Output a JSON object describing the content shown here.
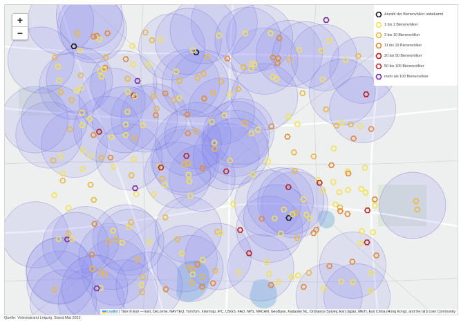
{
  "map": {
    "zoom_in_label": "+",
    "zoom_out_label": "−",
    "colors": {
      "background": "#eef0ef",
      "circle_fill": "#8a86f0",
      "circle_stroke": "#6e6ac8",
      "water": "#b9d3e6",
      "road_major": "#ffffff",
      "road_minor": "#d4d4d4"
    }
  },
  "legend": {
    "items": [
      {
        "label": "Anzahl der Bienenvölker unbekannt",
        "color": "#1a1a1a"
      },
      {
        "label": "1 bis 2 Bienenvölker",
        "color": "#f2e15c"
      },
      {
        "label": "3 bis 10 Bienenvölker",
        "color": "#e8b84a"
      },
      {
        "label": "11 bis 19 Bienenvölker",
        "color": "#df8a3c"
      },
      {
        "label": "20 bis 50 Bienenvölker",
        "color": "#b8221e"
      },
      {
        "label": "50 bis 100 Bienenvölker",
        "color": "#c53030"
      },
      {
        "label": "mehr als 100 Bienenvölker",
        "color": "#7a2fa0"
      }
    ]
  },
  "attribution": {
    "leaflet_label": "Leaflet",
    "text": "| Tiles © Esri — Esri, DeLorme, NAVTEQ, TomTom, Intermap, iPC, USGS, FAO, NPS, NRCAN, GeoBase, Kadaster NL, Ordnance Survey, Esri Japan, METI, Esri China (Hong Kong), and the GIS User Community"
  },
  "source": "Quelle: Veterinäramt Leipzig, Stand Mai 2022"
}
